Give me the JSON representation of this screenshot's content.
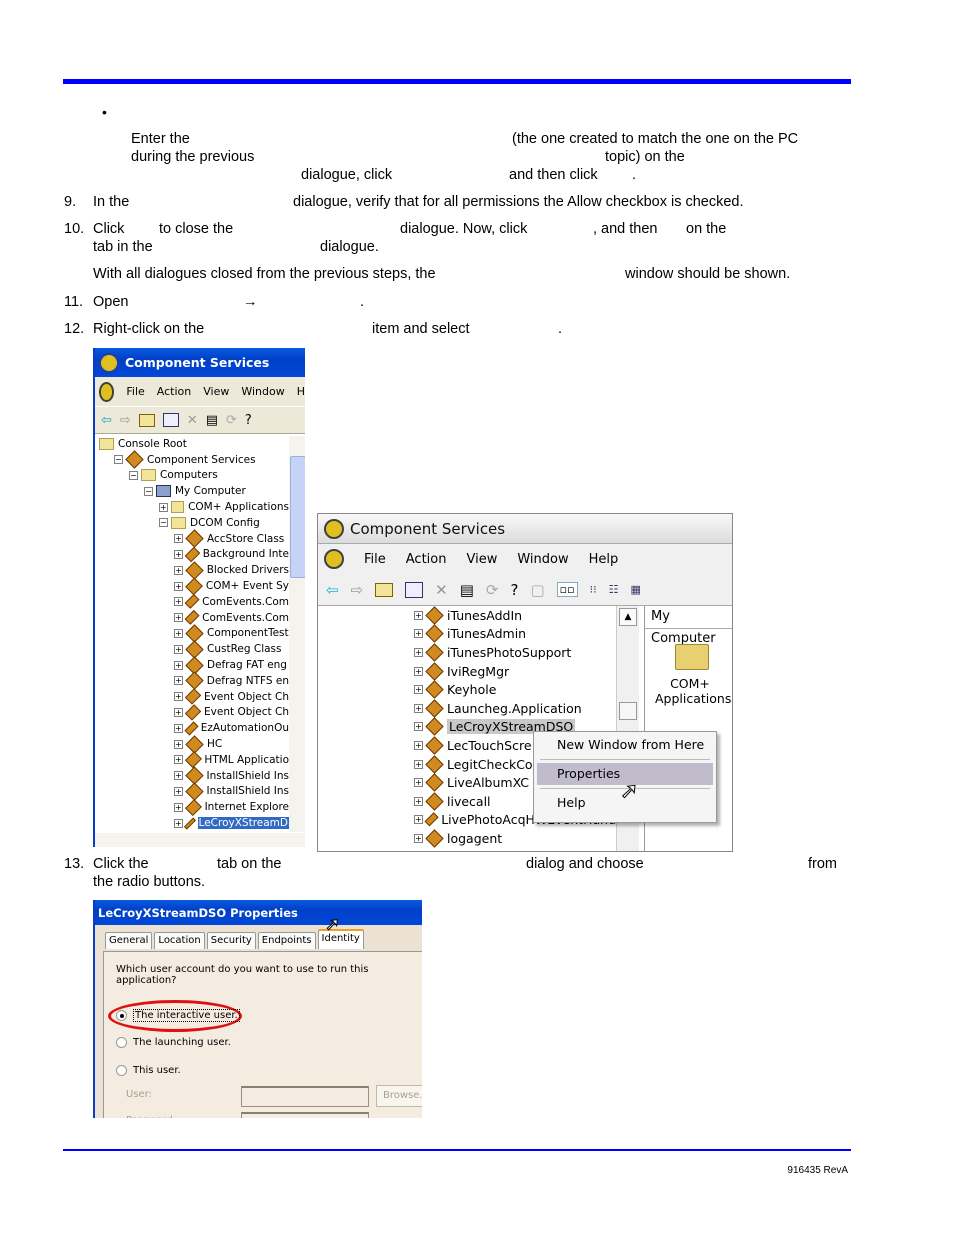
{
  "header_rule_color": "#0000ff",
  "intro": {
    "bullet": "•",
    "line1_a": "Enter the",
    "line1_b": "(the one created to match the one on the PC",
    "line2_a": "during the previous",
    "line2_b": "topic) on the",
    "line3_a": "dialogue, click",
    "line3_b": "and then click",
    "line3_c": "."
  },
  "steps": {
    "s9": {
      "num": "9.",
      "a": "In the",
      "b": "dialogue, verify that for all permissions the Allow checkbox is checked."
    },
    "s10": {
      "num": "10.",
      "a": "Click",
      "b": "to close the",
      "c": "dialogue. Now, click",
      "d": ", and then",
      "e": "on the",
      "f": "tab in the",
      "g": "dialogue."
    },
    "s10_note": {
      "a": "With all dialogues closed from the previous steps, the",
      "b": "window should be shown."
    },
    "s11": {
      "num": "11.",
      "a": "Open",
      "arrow": "→",
      "b": "."
    },
    "s12": {
      "num": "12.",
      "a": "Right-click on the",
      "b": "item and select",
      "c": "."
    },
    "s13": {
      "num": "13.",
      "a": "Click the",
      "b": "tab on the",
      "c": "dialog and choose",
      "d": "from",
      "e": "the radio buttons."
    }
  },
  "screenshot1": {
    "title": "Component Services",
    "menu": [
      "File",
      "Action",
      "View",
      "Window",
      "H"
    ],
    "tree": [
      {
        "label": "Console Root",
        "level": 0,
        "exp": "",
        "icon": "folder"
      },
      {
        "label": "Component Services",
        "level": 1,
        "exp": "−",
        "icon": "component"
      },
      {
        "label": "Computers",
        "level": 2,
        "exp": "−",
        "icon": "folder"
      },
      {
        "label": "My Computer",
        "level": 3,
        "exp": "−",
        "icon": "computer"
      },
      {
        "label": "COM+ Applications",
        "level": 4,
        "exp": "+",
        "icon": "folder"
      },
      {
        "label": "DCOM Config",
        "level": 4,
        "exp": "−",
        "icon": "folder"
      },
      {
        "label": "AccStore Class",
        "level": 5,
        "exp": "+",
        "icon": "component"
      },
      {
        "label": "Background Inte",
        "level": 5,
        "exp": "+",
        "icon": "component"
      },
      {
        "label": "Blocked Drivers",
        "level": 5,
        "exp": "+",
        "icon": "component"
      },
      {
        "label": "COM+ Event Sy",
        "level": 5,
        "exp": "+",
        "icon": "component"
      },
      {
        "label": "ComEvents.Com",
        "level": 5,
        "exp": "+",
        "icon": "component"
      },
      {
        "label": "ComEvents.Com",
        "level": 5,
        "exp": "+",
        "icon": "component"
      },
      {
        "label": "ComponentTest",
        "level": 5,
        "exp": "+",
        "icon": "component"
      },
      {
        "label": "CustReg Class",
        "level": 5,
        "exp": "+",
        "icon": "component"
      },
      {
        "label": "Defrag FAT eng",
        "level": 5,
        "exp": "+",
        "icon": "component"
      },
      {
        "label": "Defrag NTFS en",
        "level": 5,
        "exp": "+",
        "icon": "component"
      },
      {
        "label": "Event Object Ch",
        "level": 5,
        "exp": "+",
        "icon": "component"
      },
      {
        "label": "Event Object Ch",
        "level": 5,
        "exp": "+",
        "icon": "component"
      },
      {
        "label": "EzAutomationOu",
        "level": 5,
        "exp": "+",
        "icon": "component"
      },
      {
        "label": "HC",
        "level": 5,
        "exp": "+",
        "icon": "component"
      },
      {
        "label": "HTML Applicatio",
        "level": 5,
        "exp": "+",
        "icon": "component"
      },
      {
        "label": "InstallShield Ins",
        "level": 5,
        "exp": "+",
        "icon": "component"
      },
      {
        "label": "InstallShield Ins",
        "level": 5,
        "exp": "+",
        "icon": "component"
      },
      {
        "label": "Internet Explore",
        "level": 5,
        "exp": "+",
        "icon": "component"
      },
      {
        "label": "LeCroyXStreamD",
        "level": 5,
        "exp": "+",
        "icon": "component",
        "selected": true
      }
    ]
  },
  "screenshot2": {
    "title": "Component Services",
    "menu": [
      "File",
      "Action",
      "View",
      "Window",
      "Help"
    ],
    "tree": [
      {
        "label": "iTunesAddIn"
      },
      {
        "label": "iTunesAdmin"
      },
      {
        "label": "iTunesPhotoSupport"
      },
      {
        "label": "IviRegMgr"
      },
      {
        "label": "Keyhole"
      },
      {
        "label": "Launcheg.Application"
      },
      {
        "label": "LeCroyXStreamDSO",
        "selected": true
      },
      {
        "label": "LecTouchScre"
      },
      {
        "label": "LegitCheckCo"
      },
      {
        "label": "LiveAlbumXC"
      },
      {
        "label": "livecall"
      },
      {
        "label": "LivePhotoAcqHWEventHand"
      },
      {
        "label": "logagent"
      }
    ],
    "right_header": "My Computer",
    "folder_label_1": "COM+",
    "folder_label_2": "Applications",
    "context_menu": [
      {
        "label": "New Window from Here"
      },
      {
        "label": "Properties",
        "highlighted": true
      },
      {
        "label": "Help"
      }
    ]
  },
  "screenshot3": {
    "title": "LeCroyXStreamDSO Properties",
    "tabs": [
      "General",
      "Location",
      "Security",
      "Endpoints",
      "Identity"
    ],
    "active_tab": "Identity",
    "question": "Which user account do you want to use to run this application?",
    "radios": [
      {
        "label": "The interactive user.",
        "checked": true
      },
      {
        "label": "The launching user.",
        "checked": false
      },
      {
        "label": "This user.",
        "checked": false
      }
    ],
    "user_label": "User:",
    "password_label": "Password:",
    "browse_label": "Browse...",
    "highlight_color": "#e01010"
  },
  "footer": {
    "doc_number": "916435 RevA"
  }
}
